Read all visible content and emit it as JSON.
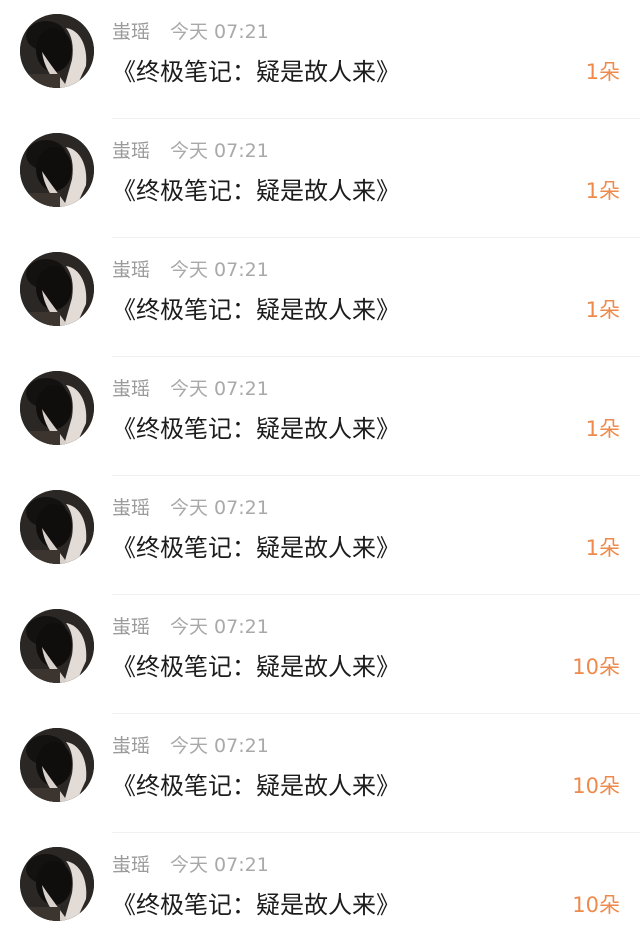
{
  "comments": [
    {
      "name": "蚩瑶",
      "time": "今天 07:21",
      "content": "《终极笔记：疑是故人来》",
      "gift": "1朵"
    },
    {
      "name": "蚩瑶",
      "time": "今天 07:21",
      "content": "《终极笔记：疑是故人来》",
      "gift": "1朵"
    },
    {
      "name": "蚩瑶",
      "time": "今天 07:21",
      "content": "《终极笔记：疑是故人来》",
      "gift": "1朵"
    },
    {
      "name": "蚩瑶",
      "time": "今天 07:21",
      "content": "《终极笔记：疑是故人来》",
      "gift": "1朵"
    },
    {
      "name": "蚩瑶",
      "time": "今天 07:21",
      "content": "《终极笔记：疑是故人来》",
      "gift": "1朵"
    },
    {
      "name": "蚩瑶",
      "time": "今天 07:21",
      "content": "《终极笔记：疑是故人来》",
      "gift": "10朵"
    },
    {
      "name": "蚩瑶",
      "time": "今天 07:21",
      "content": "《终极笔记：疑是故人来》",
      "gift": "10朵"
    },
    {
      "name": "蚩瑶",
      "time": "今天 07:21",
      "content": "《终极笔记：疑是故人来》",
      "gift": "10朵"
    }
  ],
  "colors": {
    "gift_accent": "#ee8a4b",
    "name_text": "#9b9b9b",
    "time_text": "#a9a9a9",
    "content_text": "#1c1c1c"
  },
  "icons": {
    "avatar": "user-avatar-photo"
  }
}
